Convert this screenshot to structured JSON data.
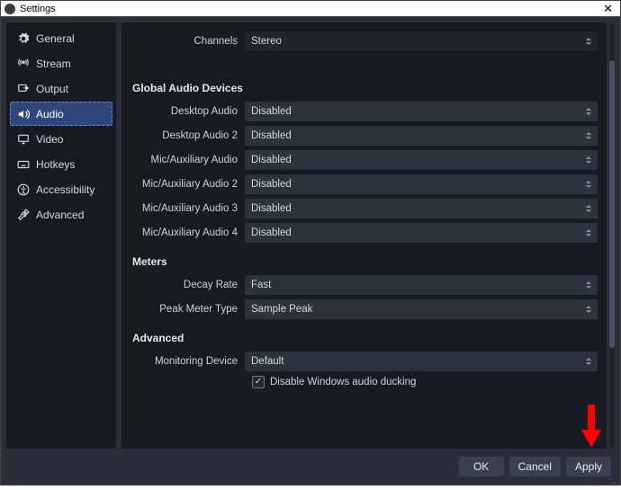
{
  "window": {
    "title": "Settings"
  },
  "sidebar": {
    "items": [
      {
        "label": "General",
        "icon": "gear-icon"
      },
      {
        "label": "Stream",
        "icon": "antenna-icon"
      },
      {
        "label": "Output",
        "icon": "output-icon"
      },
      {
        "label": "Audio",
        "icon": "speaker-icon"
      },
      {
        "label": "Video",
        "icon": "monitor-icon"
      },
      {
        "label": "Hotkeys",
        "icon": "keyboard-icon"
      },
      {
        "label": "Accessibility",
        "icon": "accessibility-icon"
      },
      {
        "label": "Advanced",
        "icon": "tools-icon"
      }
    ],
    "active_index": 3
  },
  "content": {
    "channels": {
      "label": "Channels",
      "value": "Stereo"
    },
    "global_audio": {
      "section_title": "Global Audio Devices",
      "rows": [
        {
          "label": "Desktop Audio",
          "value": "Disabled"
        },
        {
          "label": "Desktop Audio 2",
          "value": "Disabled"
        },
        {
          "label": "Mic/Auxiliary Audio",
          "value": "Disabled"
        },
        {
          "label": "Mic/Auxiliary Audio 2",
          "value": "Disabled"
        },
        {
          "label": "Mic/Auxiliary Audio 3",
          "value": "Disabled"
        },
        {
          "label": "Mic/Auxiliary Audio 4",
          "value": "Disabled"
        }
      ]
    },
    "meters": {
      "section_title": "Meters",
      "decay_rate": {
        "label": "Decay Rate",
        "value": "Fast"
      },
      "peak_meter_type": {
        "label": "Peak Meter Type",
        "value": "Sample Peak"
      }
    },
    "advanced": {
      "section_title": "Advanced",
      "monitoring_device": {
        "label": "Monitoring Device",
        "value": "Default"
      },
      "disable_ducking": {
        "label": "Disable Windows audio ducking",
        "checked": true
      }
    }
  },
  "footer": {
    "ok": "OK",
    "cancel": "Cancel",
    "apply": "Apply"
  }
}
